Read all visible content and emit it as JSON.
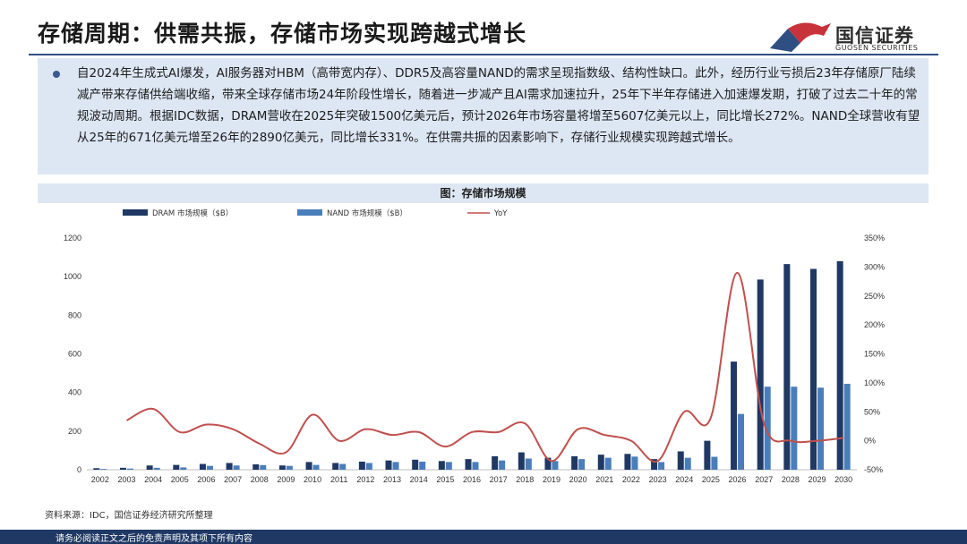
{
  "header": {
    "title": "存储周期：供需共振，存储市场实现跨越式增长",
    "logo_cn": "国信证券",
    "logo_en": "GUOSEN SECURITIES"
  },
  "summary": "自2024年生成式AI爆发，AI服务器对HBM（高带宽内存）、DDR5及高容量NAND的需求呈现指数级、结构性缺口。此外，经历行业亏损后23年存储原厂陆续减产带来存储供给端收缩，带来全球存储市场24年阶段性增长，随着进一步减产且AI需求加速拉升，25年下半年存储进入加速爆发期，打破了过去二十年的常规波动周期。根据IDC数据，DRAM营收在2025年突破1500亿美元后，预计2026年市场容量将增至5607亿美元以上，同比增长272%。NAND全球营收有望从25年的671亿美元增至26年的2890亿美元，同比增长331%。在供需共振的因素影响下，存储行业规模实现跨越式增长。",
  "chart_title": "图：存储市场规模",
  "source": "资料来源：IDC，国信证券经济研究所整理",
  "footer": "请务必阅读正文之后的免责声明及其项下所有内容",
  "colors": {
    "dram": "#1f3864",
    "nand": "#4a7ebb",
    "yoy": "#c0504d",
    "accent": "#2f4f82",
    "panel": "#dde7f4"
  },
  "chart_data": {
    "type": "bar",
    "categories": [
      "2002",
      "2003",
      "2004",
      "2005",
      "2006",
      "2007",
      "2008",
      "2009",
      "2010",
      "2011",
      "2012",
      "2013",
      "2014",
      "2015",
      "2016",
      "2017",
      "2018",
      "2019",
      "2020",
      "2021",
      "2022",
      "2023",
      "2024",
      "2025",
      "2026",
      "2027",
      "2028",
      "2029",
      "2030"
    ],
    "series": [
      {
        "name": "DRAM 市场规模（$B）",
        "type": "bar",
        "axis": "left",
        "values": [
          8,
          10,
          22,
          25,
          30,
          35,
          28,
          22,
          40,
          35,
          42,
          48,
          52,
          45,
          55,
          70,
          90,
          62,
          70,
          78,
          82,
          55,
          95,
          150,
          560,
          985,
          1065,
          1040,
          1080
        ]
      },
      {
        "name": "NAND 市场规模（$B）",
        "type": "bar",
        "axis": "left",
        "values": [
          4,
          6,
          10,
          12,
          20,
          22,
          24,
          20,
          25,
          30,
          35,
          40,
          42,
          40,
          40,
          48,
          58,
          45,
          55,
          62,
          68,
          40,
          62,
          67,
          289,
          430,
          430,
          425,
          445
        ]
      },
      {
        "name": "YoY",
        "type": "line",
        "axis": "right",
        "values": [
          null,
          35,
          55,
          15,
          28,
          20,
          -5,
          -20,
          45,
          0,
          20,
          10,
          15,
          -10,
          15,
          15,
          30,
          -35,
          20,
          10,
          0,
          -35,
          50,
          40,
          290,
          30,
          0,
          0,
          5
        ]
      }
    ],
    "y_left": {
      "min": 0,
      "max": 1200,
      "ticks": [
        0,
        200,
        400,
        600,
        800,
        1000,
        1200
      ]
    },
    "y_right": {
      "min": -50,
      "max": 350,
      "ticks": [
        "-50%",
        "0%",
        "50%",
        "100%",
        "150%",
        "200%",
        "250%",
        "300%",
        "350%"
      ]
    },
    "legend_position": "top",
    "grid": false
  }
}
